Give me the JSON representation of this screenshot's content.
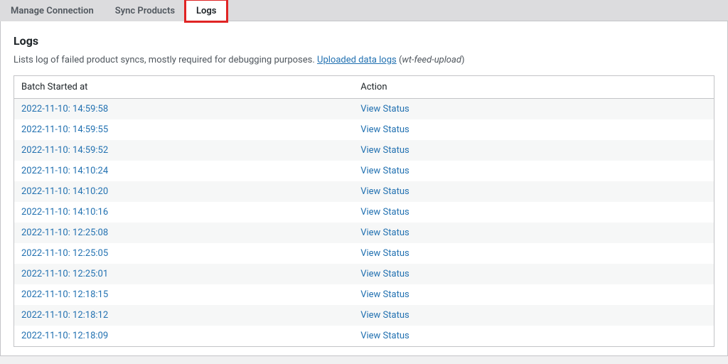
{
  "tabs": [
    {
      "label": "Manage Connection",
      "active": false,
      "highlighted": false
    },
    {
      "label": "Sync Products",
      "active": false,
      "highlighted": false
    },
    {
      "label": "Logs",
      "active": true,
      "highlighted": true
    }
  ],
  "panel": {
    "title": "Logs",
    "desc_prefix": "Lists log of failed product syncs, mostly required for debugging purposes. ",
    "desc_link_text": "Uploaded data logs",
    "desc_open_paren": " (",
    "desc_slug": "wt-feed-upload",
    "desc_close_paren": ")"
  },
  "table": {
    "columns": {
      "batch": "Batch Started at",
      "action": "Action"
    },
    "action_label": "View Status",
    "rows": [
      {
        "ts": "2022-11-10: 14:59:58"
      },
      {
        "ts": "2022-11-10: 14:59:55"
      },
      {
        "ts": "2022-11-10: 14:59:52"
      },
      {
        "ts": "2022-11-10: 14:10:24"
      },
      {
        "ts": "2022-11-10: 14:10:20"
      },
      {
        "ts": "2022-11-10: 14:10:16"
      },
      {
        "ts": "2022-11-10: 12:25:08"
      },
      {
        "ts": "2022-11-10: 12:25:05"
      },
      {
        "ts": "2022-11-10: 12:25:01"
      },
      {
        "ts": "2022-11-10: 12:18:15"
      },
      {
        "ts": "2022-11-10: 12:18:12"
      },
      {
        "ts": "2022-11-10: 12:18:09"
      }
    ]
  }
}
